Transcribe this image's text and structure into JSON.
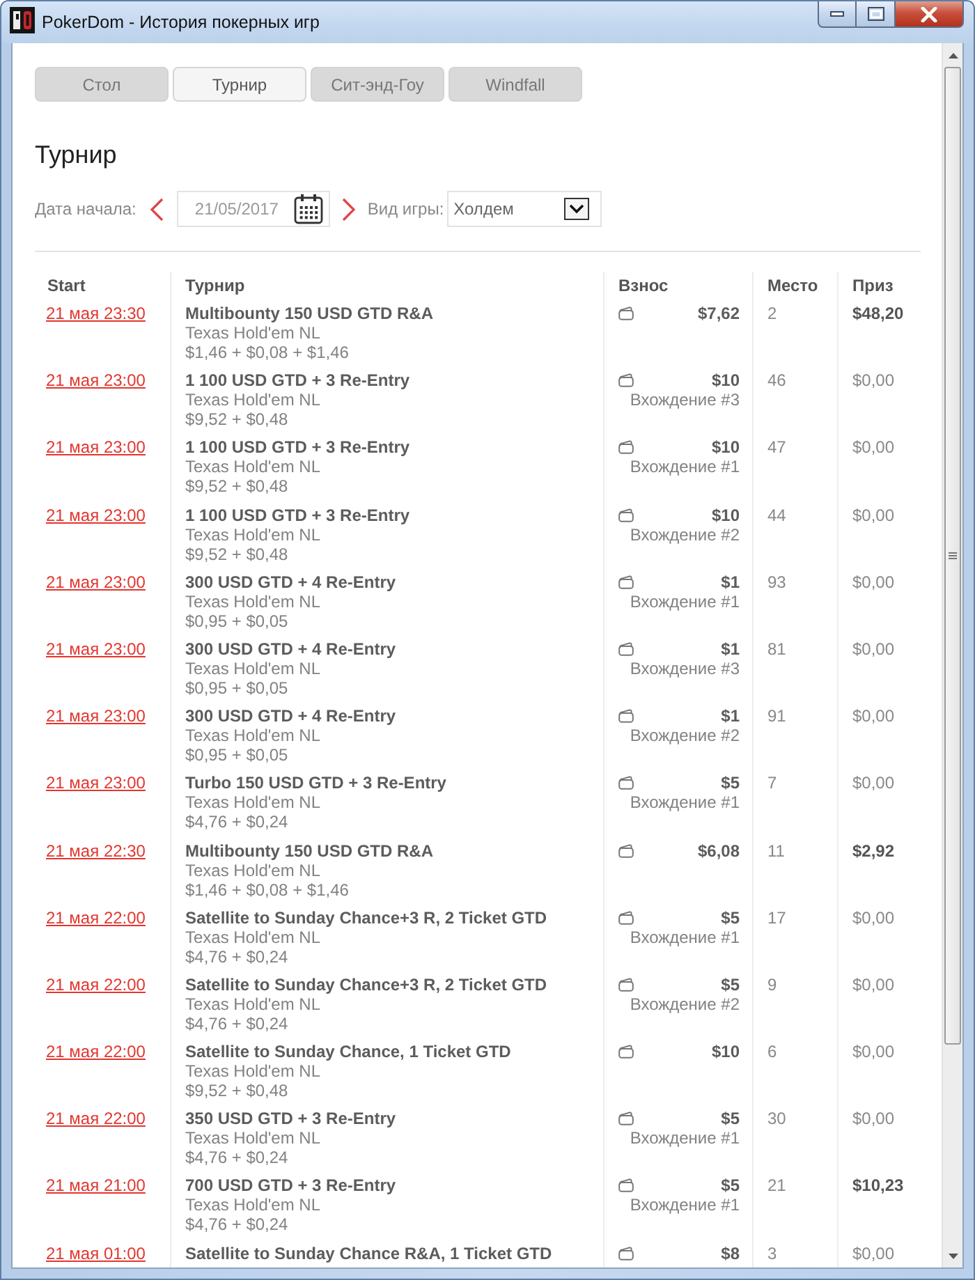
{
  "window": {
    "title": "PokerDom - История покерных игр"
  },
  "tabs": [
    {
      "label": "Стол",
      "selected": false
    },
    {
      "label": "Турнир",
      "selected": true
    },
    {
      "label": "Сит-энд-Гоу",
      "selected": false
    },
    {
      "label": "Windfall",
      "selected": false
    }
  ],
  "heading": "Турнир",
  "filters": {
    "date_label": "Дата начала:",
    "date": "21/05/2017",
    "game_label": "Вид игры:",
    "game": "Холдем"
  },
  "table": {
    "columns": [
      "Start",
      "Турнир",
      "Взнос",
      "Место",
      "Приз"
    ],
    "rows": [
      {
        "start": "21 мая 23:30",
        "name": "Multibounty 150 USD GTD R&A",
        "game": "Texas Hold'em NL",
        "buyin_parts": "$1,46 + $0,08 + $1,46",
        "buyin": "$7,62",
        "place": "2",
        "prize": "$48,20",
        "prize_bold": true
      },
      {
        "start": "21 мая 23:00",
        "name": "1 100 USD GTD + 3 Re-Entry",
        "game": "Texas Hold'em NL",
        "buyin_parts": "$9,52 + $0,48",
        "buyin": "$10",
        "entry": "Вхождение #3",
        "place": "46",
        "prize": "$0,00",
        "prize_bold": false
      },
      {
        "start": "21 мая 23:00",
        "name": "1 100 USD GTD + 3 Re-Entry",
        "game": "Texas Hold'em NL",
        "buyin_parts": "$9,52 + $0,48",
        "buyin": "$10",
        "entry": "Вхождение #1",
        "place": "47",
        "prize": "$0,00",
        "prize_bold": false
      },
      {
        "start": "21 мая 23:00",
        "name": "1 100 USD GTD + 3 Re-Entry",
        "game": "Texas Hold'em NL",
        "buyin_parts": "$9,52 + $0,48",
        "buyin": "$10",
        "entry": "Вхождение #2",
        "place": "44",
        "prize": "$0,00",
        "prize_bold": false
      },
      {
        "start": "21 мая 23:00",
        "name": "300 USD GTD + 4 Re-Entry",
        "game": "Texas Hold'em NL",
        "buyin_parts": "$0,95 + $0,05",
        "buyin": "$1",
        "entry": "Вхождение #1",
        "place": "93",
        "prize": "$0,00",
        "prize_bold": false
      },
      {
        "start": "21 мая 23:00",
        "name": "300 USD GTD + 4 Re-Entry",
        "game": "Texas Hold'em NL",
        "buyin_parts": "$0,95 + $0,05",
        "buyin": "$1",
        "entry": "Вхождение #3",
        "place": "81",
        "prize": "$0,00",
        "prize_bold": false
      },
      {
        "start": "21 мая 23:00",
        "name": "300 USD GTD + 4 Re-Entry",
        "game": "Texas Hold'em NL",
        "buyin_parts": "$0,95 + $0,05",
        "buyin": "$1",
        "entry": "Вхождение #2",
        "place": "91",
        "prize": "$0,00",
        "prize_bold": false
      },
      {
        "start": "21 мая 23:00",
        "name": "Turbo 150 USD GTD + 3 Re-Entry",
        "game": "Texas Hold'em NL",
        "buyin_parts": "$4,76 + $0,24",
        "buyin": "$5",
        "entry": "Вхождение #1",
        "place": "7",
        "prize": "$0,00",
        "prize_bold": false
      },
      {
        "start": "21 мая 22:30",
        "name": "Multibounty 150 USD GTD R&A",
        "game": "Texas Hold'em NL",
        "buyin_parts": "$1,46 + $0,08 + $1,46",
        "buyin": "$6,08",
        "place": "11",
        "prize": "$2,92",
        "prize_bold": true
      },
      {
        "start": "21 мая 22:00",
        "name": "Satellite to Sunday Chance+3 R, 2 Ticket GTD",
        "game": "Texas Hold'em NL",
        "buyin_parts": "$4,76 + $0,24",
        "buyin": "$5",
        "entry": "Вхождение #1",
        "place": "17",
        "prize": "$0,00",
        "prize_bold": false
      },
      {
        "start": "21 мая 22:00",
        "name": "Satellite to Sunday Chance+3 R, 2 Ticket GTD",
        "game": "Texas Hold'em NL",
        "buyin_parts": "$4,76 + $0,24",
        "buyin": "$5",
        "entry": "Вхождение #2",
        "place": "9",
        "prize": "$0,00",
        "prize_bold": false
      },
      {
        "start": "21 мая 22:00",
        "name": "Satellite to Sunday Chance, 1 Ticket GTD",
        "game": "Texas Hold'em NL",
        "buyin_parts": "$9,52 + $0,48",
        "buyin": "$10",
        "place": "6",
        "prize": "$0,00",
        "prize_bold": false
      },
      {
        "start": "21 мая 22:00",
        "name": "350 USD GTD + 3 Re-Entry",
        "game": "Texas Hold'em NL",
        "buyin_parts": "$4,76 + $0,24",
        "buyin": "$5",
        "entry": "Вхождение #1",
        "place": "30",
        "prize": "$0,00",
        "prize_bold": false
      },
      {
        "start": "21 мая 21:00",
        "name": "700 USD GTD + 3 Re-Entry",
        "game": "Texas Hold'em NL",
        "buyin_parts": "$4,76 + $0,24",
        "buyin": "$5",
        "entry": "Вхождение #1",
        "place": "21",
        "prize": "$10,23",
        "prize_bold": true
      },
      {
        "start": "21 мая 01:00",
        "name": "Satellite to Sunday Chance R&A, 1 Ticket GTD",
        "buyin": "$8",
        "place": "3",
        "prize": "$0,00",
        "prize_bold": false
      }
    ]
  }
}
